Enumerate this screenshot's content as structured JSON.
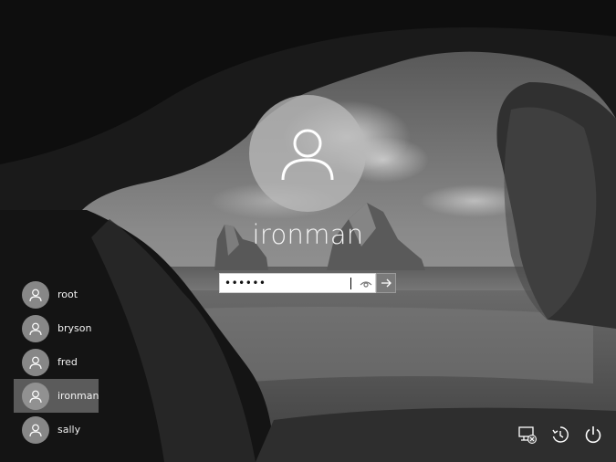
{
  "selected_user": {
    "name": "ironman",
    "avatar_icon": "user-silhouette-icon"
  },
  "password": {
    "value": "••••••",
    "reveal_icon": "eye-icon",
    "submit_icon": "arrow-right-icon"
  },
  "users": [
    {
      "name": "root",
      "selected": false
    },
    {
      "name": "bryson",
      "selected": false
    },
    {
      "name": "fred",
      "selected": false
    },
    {
      "name": "ironman",
      "selected": true
    },
    {
      "name": "sally",
      "selected": false
    }
  ],
  "corner_icons": {
    "network": "network-disconnected-icon",
    "accessibility": "ease-of-access-icon",
    "power": "power-icon"
  },
  "colors": {
    "text": "#f4f4f4",
    "selected_bg": "#969696",
    "field_bg": "#ffffff"
  }
}
